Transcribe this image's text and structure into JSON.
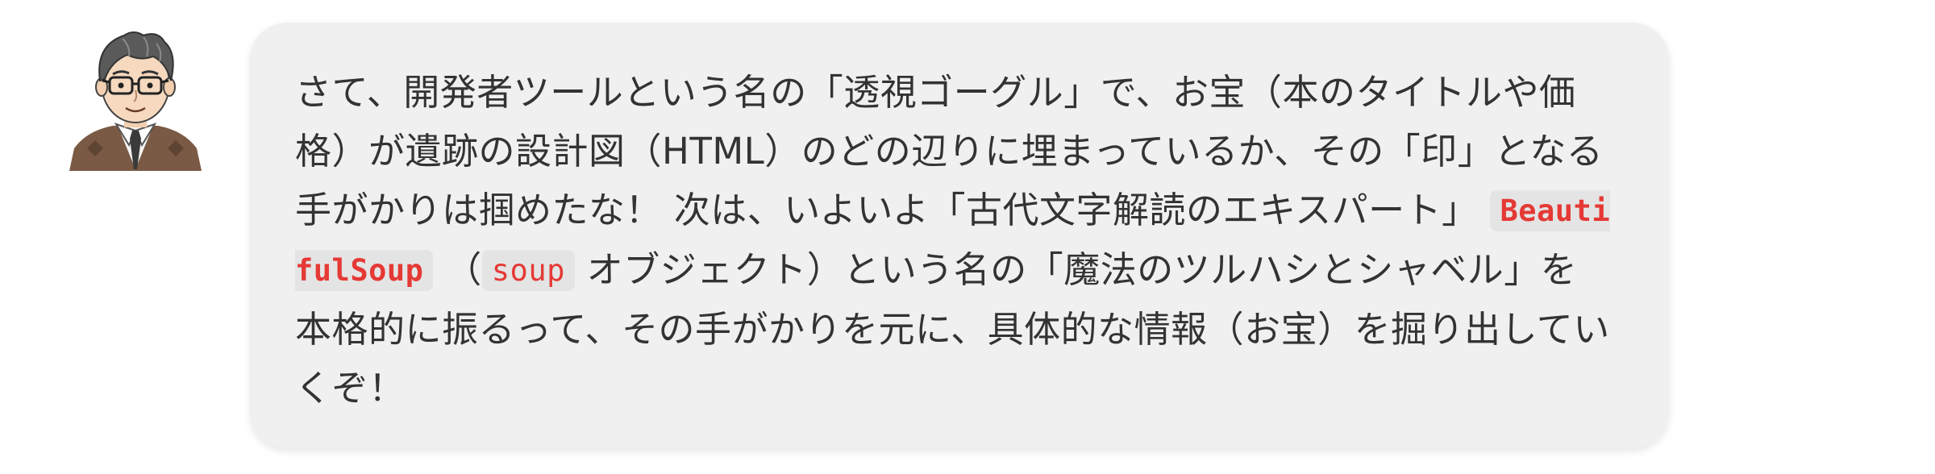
{
  "message": {
    "part1": "さて、開発者ツールという名の「透視ゴーグル」で、お宝（本のタイトルや価格）が遺跡の設計図（HTML）のどの辺りに埋まっているか、その「印」となる手がかりは掴めたな！ 次は、いよいよ「古代文字解読のエキスパート」",
    "code1": "BeautifulSoup",
    "part2": "（",
    "code2": "soup",
    "part3": "オブジェクト）という名の「魔法のツルハシとシャベル」を本格的に振るって、その手がかりを元に、具体的な情報（お宝）を掘り出していくぞ！"
  },
  "avatar": {
    "icon": "teacher-avatar-icon"
  },
  "colors": {
    "bubble_bg": "#f0f0f0",
    "text": "#333333",
    "code_text": "#e53935",
    "code_bg": "#e4e4e4"
  }
}
